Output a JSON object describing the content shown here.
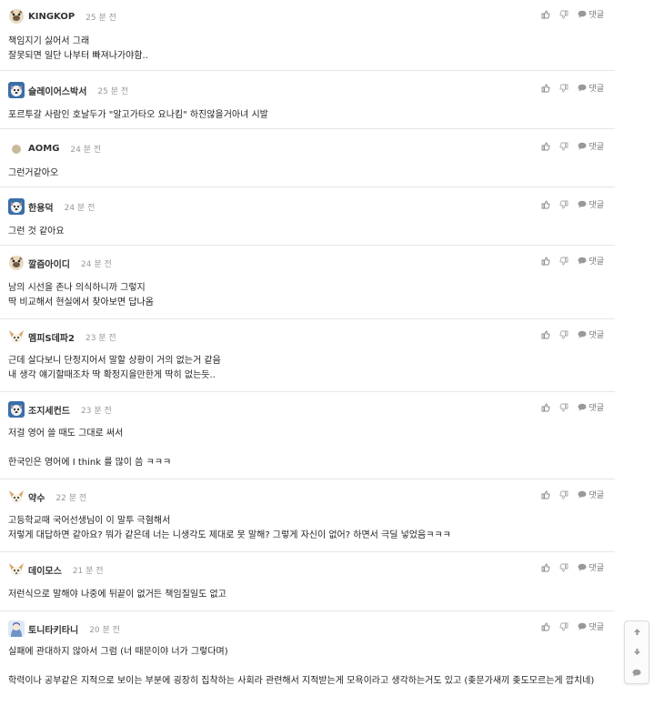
{
  "actions": {
    "reply_label": "댓글"
  },
  "comments": [
    {
      "nick": "KINGKOP",
      "time": "25 분 전",
      "avatar": "pug-icon",
      "lines": [
        "책임지기 싫어서 그래",
        "잘못되면 일단 나부터 빠져나가야함.."
      ]
    },
    {
      "nick": "슬레이어스박서",
      "time": "25 분 전",
      "avatar": "dog-icon",
      "lines": [
        "포르투갈 사람인 호날두가 \"알고가타오 요나킴\" 하진않을거아녀 시발"
      ]
    },
    {
      "nick": "AOMG",
      "time": "24 분 전",
      "avatar": "circle-avatar-icon",
      "lines": [
        "그런거같아오"
      ]
    },
    {
      "nick": "한용덕",
      "time": "24 분 전",
      "avatar": "dog-icon",
      "lines": [
        "그런 것 같아요"
      ]
    },
    {
      "nick": "깔즘아이디",
      "time": "24 분 전",
      "avatar": "pug-icon",
      "lines": [
        "남의 시선을 존나 의식하니까 그렇지",
        "딱 비교해서 현실에서 찾아보면 답나옴"
      ]
    },
    {
      "nick": "멤피S데파2",
      "time": "23 분 전",
      "avatar": "chihuahua-icon",
      "lines": [
        "근데 살다보니 단정지어서 말할 상황이 거의 없는거 같음",
        "내 생각 얘기할때조차 딱 확정지을만한게 딱히 없는듯.."
      ]
    },
    {
      "nick": "조지세컨드",
      "time": "23 분 전",
      "avatar": "dog-icon",
      "lines": [
        "저걸 영어 쓸 때도 그대로 써서",
        "",
        "한국인은 영어에 I think 를 많이 씀 ㅋㅋㅋ"
      ]
    },
    {
      "nick": "약수",
      "time": "22 분 전",
      "avatar": "chihuahua-icon",
      "lines": [
        "고등학교때 국어선생님이 이 말투 극혐해서",
        "저렇게 대답하면 같아요? 뭐가 같은데 너는 니생각도 제대로 못 말해? 그렇게 자신이 없어? 하면서 극딜 넣었음ㅋㅋㅋ"
      ]
    },
    {
      "nick": "데이모스",
      "time": "21 분 전",
      "avatar": "chihuahua-icon",
      "lines": [
        "저런식으로 말해야 나중에 뒤끝이 없거든 책임질일도 없고"
      ]
    },
    {
      "nick": "토니타키타니",
      "time": "20 분 전",
      "avatar": "anime-avatar-icon",
      "lines": [
        "실패에 관대하지 않아서 그럼 (너 때문이야 너가 그렇다며)",
        "",
        "학력이나 공부같은 지적으로 보이는 부분에 굉장히 집착하는 사회라 관련해서 지적받는게 모욕이라고 생각하는거도 있고 (좆문가새끼 좆도모르는게 깝치네)"
      ]
    }
  ],
  "float_bar": {
    "up_icon": "arrow-up-icon",
    "down_icon": "arrow-down-icon",
    "comment_icon": "comment-icon"
  }
}
